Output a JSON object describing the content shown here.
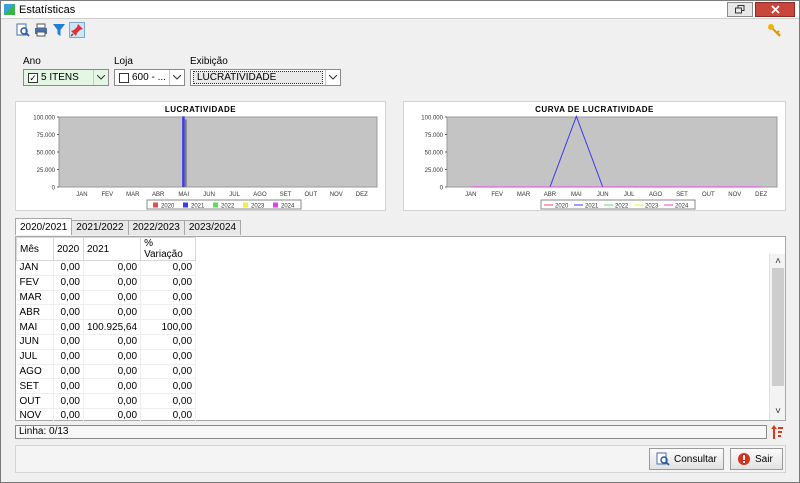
{
  "window": {
    "title": "Estatísticas"
  },
  "filters": {
    "ano_label": "Ano",
    "ano_value": "5 ITENS",
    "loja_label": "Loja",
    "loja_value": "600 - ...",
    "exibicao_label": "Exibição",
    "exibicao_value": "LUCRATIVIDADE"
  },
  "chart_data": [
    {
      "type": "bar",
      "title": "LUCRATIVIDADE",
      "categories": [
        "JAN",
        "FEV",
        "MAR",
        "ABR",
        "MAI",
        "JUN",
        "JUL",
        "AGO",
        "SET",
        "OUT",
        "NOV",
        "DEZ"
      ],
      "yticks": [
        "0",
        "25.000",
        "50.000",
        "75.000",
        "100.000"
      ],
      "ylim": [
        0,
        100000
      ],
      "series": [
        {
          "name": "2020",
          "color": "#e84c4c",
          "values": [
            0,
            0,
            0,
            0,
            0,
            0,
            0,
            0,
            0,
            0,
            0,
            0
          ]
        },
        {
          "name": "2021",
          "color": "#3b3bf0",
          "values": [
            0,
            0,
            0,
            0,
            100925.64,
            0,
            0,
            0,
            0,
            0,
            0,
            0
          ]
        },
        {
          "name": "2022",
          "color": "#58e058",
          "values": [
            0,
            0,
            0,
            0,
            0,
            0,
            0,
            0,
            0,
            0,
            0,
            0
          ]
        },
        {
          "name": "2023",
          "color": "#f0f040",
          "values": [
            0,
            0,
            0,
            0,
            0,
            0,
            0,
            0,
            0,
            0,
            0,
            0
          ]
        },
        {
          "name": "2024",
          "color": "#e840e8",
          "values": [
            0,
            0,
            0,
            0,
            0,
            0,
            0,
            0,
            0,
            0,
            0,
            0
          ]
        }
      ],
      "legend": "bottom",
      "grid": false
    },
    {
      "type": "line",
      "title": "CURVA DE LUCRATIVIDADE",
      "categories": [
        "JAN",
        "FEV",
        "MAR",
        "ABR",
        "MAI",
        "JUN",
        "JUL",
        "AGO",
        "SET",
        "OUT",
        "NOV",
        "DEZ"
      ],
      "yticks": [
        "0",
        "25.000",
        "50.000",
        "75.000",
        "100.000"
      ],
      "ylim": [
        0,
        100000
      ],
      "series": [
        {
          "name": "2020",
          "color": "#e84c4c",
          "values": [
            0,
            0,
            0,
            0,
            0,
            0,
            0,
            0,
            0,
            0,
            0,
            0
          ]
        },
        {
          "name": "2021",
          "color": "#3b3bf0",
          "values": [
            0,
            0,
            0,
            0,
            100925.64,
            0,
            0,
            0,
            0,
            0,
            0,
            0
          ]
        },
        {
          "name": "2022",
          "color": "#58e058",
          "values": [
            0,
            0,
            0,
            0,
            0,
            0,
            0,
            0,
            0,
            0,
            0,
            0
          ]
        },
        {
          "name": "2023",
          "color": "#f0f040",
          "values": [
            0,
            0,
            0,
            0,
            0,
            0,
            0,
            0,
            0,
            0,
            0,
            0
          ]
        },
        {
          "name": "2024",
          "color": "#e840e8",
          "values": [
            0,
            0,
            0,
            0,
            0,
            0,
            0,
            0,
            0,
            0,
            0,
            0
          ]
        }
      ],
      "legend": "bottom",
      "grid": false
    }
  ],
  "tabs": [
    "2020/2021",
    "2021/2022",
    "2022/2023",
    "2023/2024"
  ],
  "table": {
    "headers": [
      "Mês",
      "2020",
      "2021",
      "% Variação"
    ],
    "rows": [
      [
        "JAN",
        "0,00",
        "0,00",
        "0,00"
      ],
      [
        "FEV",
        "0,00",
        "0,00",
        "0,00"
      ],
      [
        "MAR",
        "0,00",
        "0,00",
        "0,00"
      ],
      [
        "ABR",
        "0,00",
        "0,00",
        "0,00"
      ],
      [
        "MAI",
        "0,00",
        "100.925,64",
        "100,00"
      ],
      [
        "JUN",
        "0,00",
        "0,00",
        "0,00"
      ],
      [
        "JUL",
        "0,00",
        "0,00",
        "0,00"
      ],
      [
        "AGO",
        "0,00",
        "0,00",
        "0,00"
      ],
      [
        "SET",
        "0,00",
        "0,00",
        "0,00"
      ],
      [
        "OUT",
        "0,00",
        "0,00",
        "0,00"
      ],
      [
        "NOV",
        "0,00",
        "0,00",
        "0,00"
      ]
    ]
  },
  "status": {
    "linha": "Linha: 0/13"
  },
  "buttons": {
    "consultar": "Consultar",
    "sair": "Sair"
  },
  "icons": {
    "toolbar": [
      "search-document-icon",
      "print-icon",
      "filter-icon",
      "pin-icon"
    ],
    "key": "key-icon",
    "sort": "sort-icon"
  }
}
